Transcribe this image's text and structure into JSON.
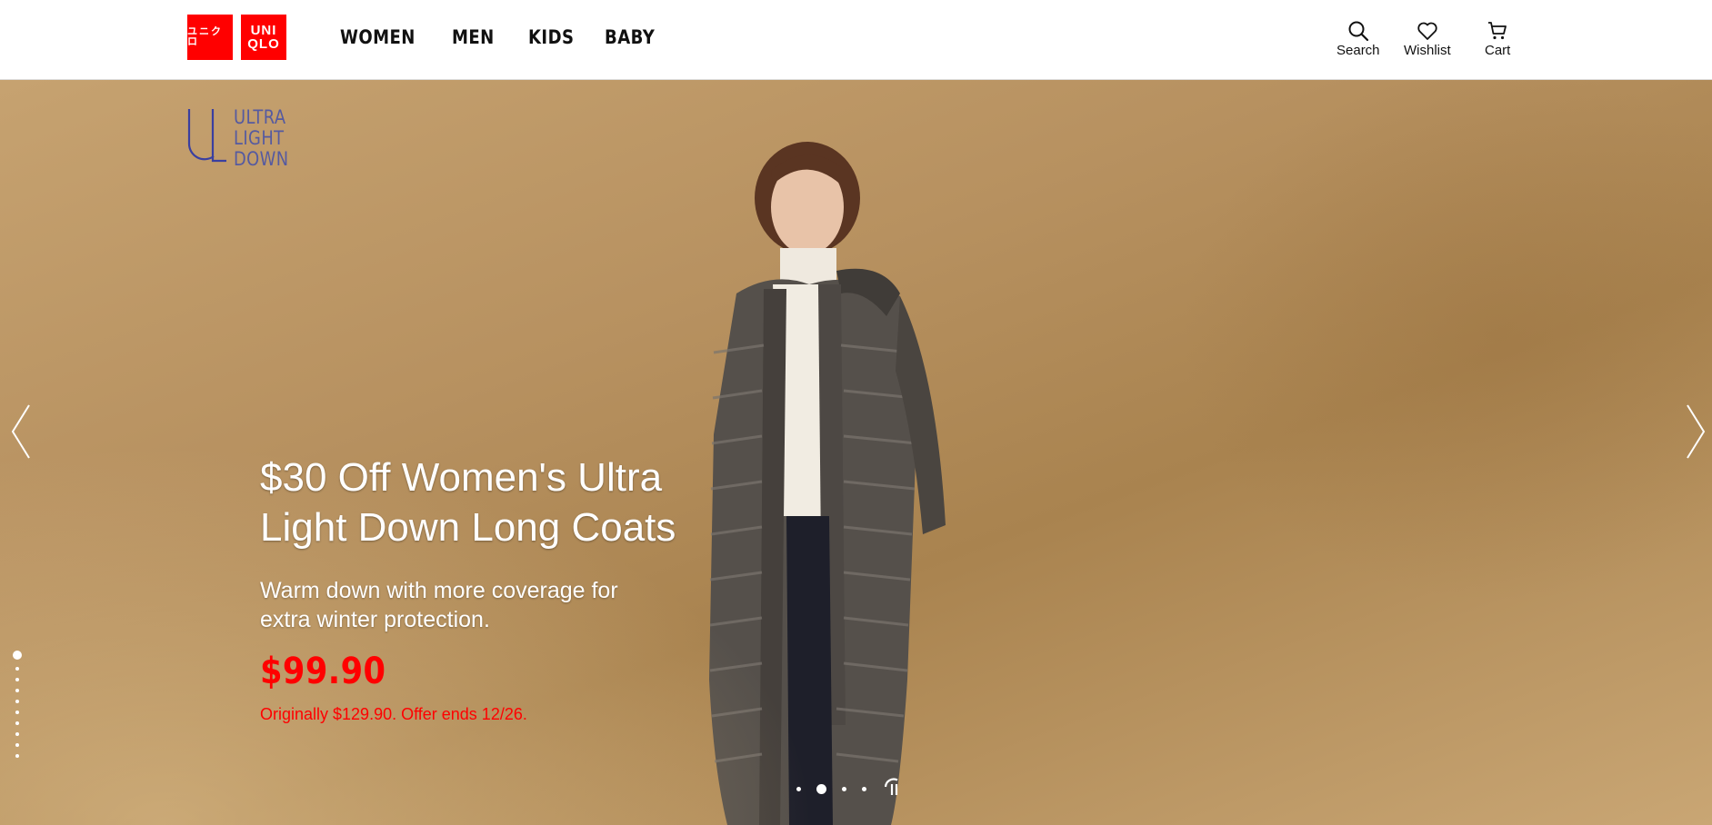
{
  "brand": {
    "logo_kana": "ユニクロ",
    "logo_top": "UNI",
    "logo_bottom": "QLO",
    "colors": {
      "brand_red": "#ff0000",
      "sale_red": "#ff0000",
      "uld_purple": "#555aa0"
    }
  },
  "nav": {
    "items": [
      {
        "label": "WOMEN"
      },
      {
        "label": "MEN"
      },
      {
        "label": "KIDS"
      },
      {
        "label": "BABY"
      }
    ]
  },
  "utility": {
    "search": {
      "label": "Search",
      "icon": "search-icon"
    },
    "wishlist": {
      "label": "Wishlist",
      "icon": "heart-icon"
    },
    "cart": {
      "label": "Cart",
      "icon": "cart-icon"
    }
  },
  "hero": {
    "badge_lines": [
      "ULTRA",
      "LIGHT",
      "DOWN"
    ],
    "headline": "$30 Off Women's Ultra Light Down Long Coats",
    "subline": "Warm down with more coverage for extra winter protection.",
    "price": "$99.90",
    "offer": "Originally $129.90. Offer ends 12/26.",
    "carousel": {
      "total_slides": 4,
      "active_slide": 2,
      "vertical_total": 10,
      "vertical_active": 1,
      "prev_icon": "chevron-left-icon",
      "next_icon": "chevron-right-icon",
      "pause_icon": "pause-icon"
    }
  }
}
